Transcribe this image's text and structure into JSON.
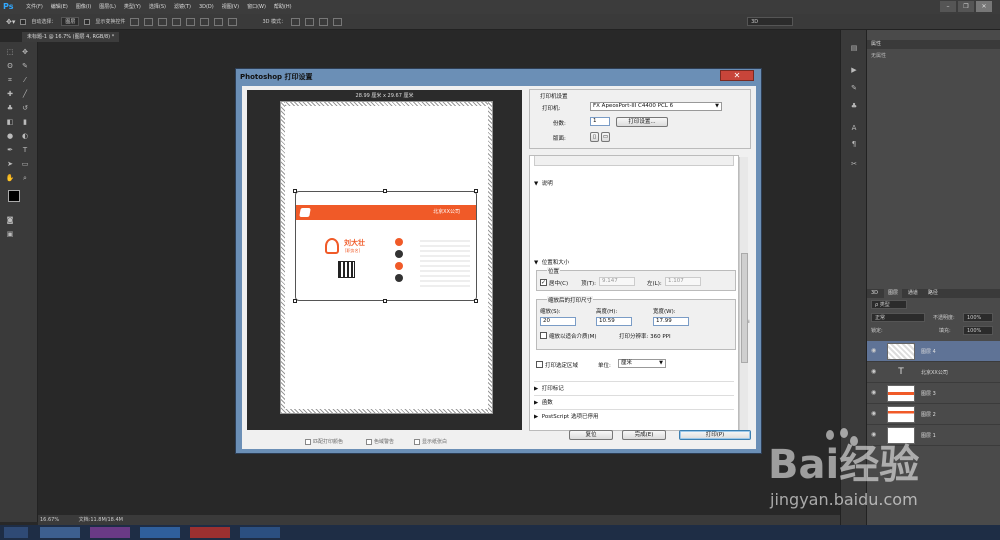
{
  "app": {
    "logo": "Ps",
    "menu": [
      "文件(F)",
      "编辑(E)",
      "图像(I)",
      "图层(L)",
      "类型(Y)",
      "选择(S)",
      "滤镜(T)",
      "3D(D)",
      "视图(V)",
      "窗口(W)",
      "帮助(H)"
    ]
  },
  "options_bar": {
    "auto_select_label": "自动选择：",
    "auto_select_value": "图层",
    "show_transform_label": "显示变换控件",
    "mode_3d_label": "3D 模式：",
    "workspace": "3D"
  },
  "document_tab": "未标题-1 @ 16.7% (图层 4, RGB/8) *",
  "status": {
    "zoom": "16.67%",
    "doc_size": "文档:11.8M/18.4M"
  },
  "panels": {
    "properties_tab": "属性",
    "properties_empty": "无属性",
    "tabs_3d": "3D",
    "layers_tab": "图层",
    "channels_tab": "通道",
    "paths_tab": "路径",
    "kind_filter": "ρ 类型",
    "blend_mode": "正常",
    "opacity_label": "不透明度:",
    "opacity_value": "100%",
    "lock_label": "锁定:",
    "fill_label": "填充:",
    "fill_value": "100%",
    "layers": [
      {
        "name": "图层 4",
        "selected": true,
        "kind": "pixel"
      },
      {
        "name": "北京XX公司",
        "selected": false,
        "kind": "text"
      },
      {
        "name": "图层 3",
        "selected": false,
        "kind": "pixel"
      },
      {
        "name": "图层 2",
        "selected": false,
        "kind": "pixel"
      },
      {
        "name": "图层 1",
        "selected": false,
        "kind": "pixel"
      }
    ]
  },
  "dialog": {
    "title": "Photoshop 打印设置",
    "close_symbol": "✕",
    "paper_size": "28.99 厘米 x 29.67 厘米",
    "card": {
      "company": "北京XX公司",
      "name": "刘大壮",
      "job_title": "[职务名]"
    },
    "printer_section": "打印机设置",
    "printer_label": "打印机:",
    "printer_value": "FX ApeosPort-III C4400 PCL 6",
    "copies_label": "份数:",
    "copies_value": "1",
    "print_settings_button": "打印设置...",
    "layout_label": "版面:",
    "description_section": "说明",
    "position_size_section": "位置和大小",
    "position_label": "位置",
    "center_label": "居中(C)",
    "top_label": "顶(T):",
    "top_value": "9.147",
    "left_label": "左(L):",
    "left_value": "1.107",
    "scaled_size_label": "缩放后的打印尺寸",
    "scale_label": "缩放(S):",
    "scale_value": "20",
    "height_label": "高度(H):",
    "height_value": "10.59",
    "width_label": "宽度(W):",
    "width_value": "17.99",
    "fit_media_label": "缩放以适合介质(M)",
    "resolution_text": "打印分辨率: 360 PPI",
    "print_selected_label": "打印选定区域",
    "unit_label": "单位:",
    "unit_value": "厘米",
    "marks_section": "打印标记",
    "functions_section": "函数",
    "postscript_section": "PostScript 选项已停用",
    "match_colors": "匹配打印颜色",
    "gamut_warning": "色域警告",
    "show_paper_white": "显示纸张白",
    "reset_button": "复位",
    "done_button": "完成(E)",
    "print_button": "打印(P)"
  },
  "watermark": {
    "brand": "Bai经验",
    "url": "jingyan.baidu.com"
  },
  "colors": {
    "accent_orange": "#f05a28",
    "ps_blue": "#31a8ff",
    "dialog_frame": "#6b8fb6"
  }
}
